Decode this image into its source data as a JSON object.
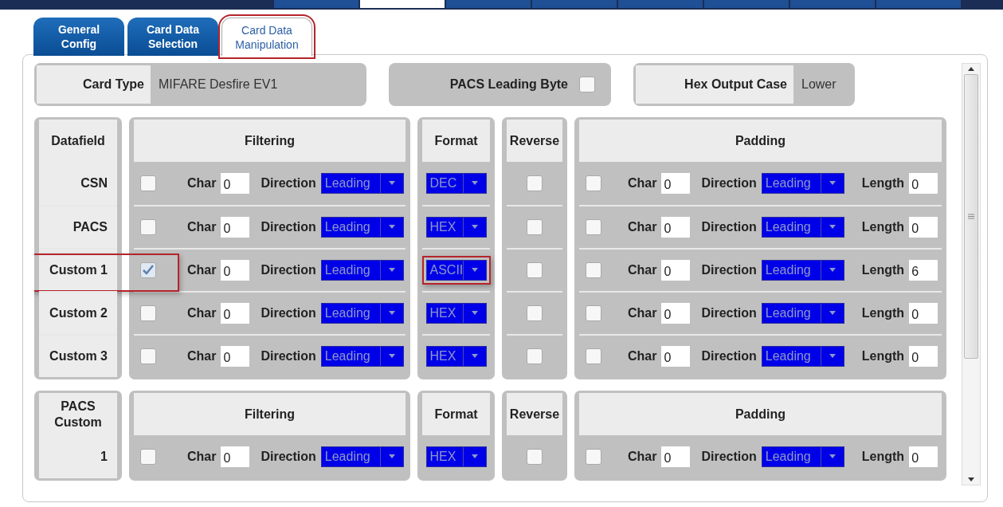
{
  "nav_tabs": [
    {
      "selected": false
    },
    {
      "selected": true
    },
    {
      "selected": false
    },
    {
      "selected": false
    },
    {
      "selected": false
    },
    {
      "selected": false
    },
    {
      "selected": false
    },
    {
      "selected": false
    }
  ],
  "tabs": [
    {
      "label": "General Config",
      "selected": false,
      "highlighted": false
    },
    {
      "label": "Card Data Selection",
      "selected": false,
      "highlighted": false
    },
    {
      "label": "Card Data Manipulation",
      "selected": true,
      "highlighted": true
    }
  ],
  "settings": [
    {
      "kind": "value",
      "label": "Card Type",
      "value": "MIFARE Desfire EV1"
    },
    {
      "kind": "checkbox",
      "label": "PACS Leading Byte",
      "checked": false
    },
    {
      "kind": "value",
      "label": "Hex Output Case",
      "value": "Lower"
    }
  ],
  "tables": [
    {
      "datafield_header": "Datafield",
      "filtering_header": "Filtering",
      "format_header": "Format",
      "reverse_header": "Reverse",
      "padding_header": "Padding",
      "rows": [
        {
          "datafield": "CSN",
          "highlighted": false,
          "filter_checked": false,
          "char_label": "Char",
          "char": "0",
          "direction_label": "Direction",
          "direction": "Leading",
          "format": "DEC",
          "format_highlighted": false,
          "reverse": false,
          "pad_checked": false,
          "pad_char_label": "Char",
          "pad_char": "0",
          "pad_direction_label": "Direction",
          "pad_direction": "Leading",
          "length_label": "Length",
          "length": "0"
        },
        {
          "datafield": "PACS",
          "highlighted": false,
          "filter_checked": false,
          "char_label": "Char",
          "char": "0",
          "direction_label": "Direction",
          "direction": "Leading",
          "format": "HEX",
          "format_highlighted": false,
          "reverse": false,
          "pad_checked": false,
          "pad_char_label": "Char",
          "pad_char": "0",
          "pad_direction_label": "Direction",
          "pad_direction": "Leading",
          "length_label": "Length",
          "length": "0"
        },
        {
          "datafield": "Custom 1",
          "highlighted": true,
          "filter_checked": true,
          "char_label": "Char",
          "char": "0",
          "direction_label": "Direction",
          "direction": "Leading",
          "format": "ASCII",
          "format_highlighted": true,
          "reverse": false,
          "pad_checked": false,
          "pad_char_label": "Char",
          "pad_char": "0",
          "pad_direction_label": "Direction",
          "pad_direction": "Leading",
          "length_label": "Length",
          "length": "6"
        },
        {
          "datafield": "Custom 2",
          "highlighted": false,
          "filter_checked": false,
          "char_label": "Char",
          "char": "0",
          "direction_label": "Direction",
          "direction": "Leading",
          "format": "HEX",
          "format_highlighted": false,
          "reverse": false,
          "pad_checked": false,
          "pad_char_label": "Char",
          "pad_char": "0",
          "pad_direction_label": "Direction",
          "pad_direction": "Leading",
          "length_label": "Length",
          "length": "0"
        },
        {
          "datafield": "Custom 3",
          "highlighted": false,
          "filter_checked": false,
          "char_label": "Char",
          "char": "0",
          "direction_label": "Direction",
          "direction": "Leading",
          "format": "HEX",
          "format_highlighted": false,
          "reverse": false,
          "pad_checked": false,
          "pad_char_label": "Char",
          "pad_char": "0",
          "pad_direction_label": "Direction",
          "pad_direction": "Leading",
          "length_label": "Length",
          "length": "0"
        }
      ]
    },
    {
      "datafield_header": "PACS Custom",
      "filtering_header": "Filtering",
      "format_header": "Format",
      "reverse_header": "Reverse",
      "padding_header": "Padding",
      "rows": [
        {
          "datafield": "1",
          "highlighted": false,
          "filter_checked": false,
          "char_label": "Char",
          "char": "0",
          "direction_label": "Direction",
          "direction": "Leading",
          "format": "HEX",
          "format_highlighted": false,
          "reverse": false,
          "pad_checked": false,
          "pad_char_label": "Char",
          "pad_char": "0",
          "pad_direction_label": "Direction",
          "pad_direction": "Leading",
          "length_label": "Length",
          "length": "0"
        }
      ]
    }
  ]
}
